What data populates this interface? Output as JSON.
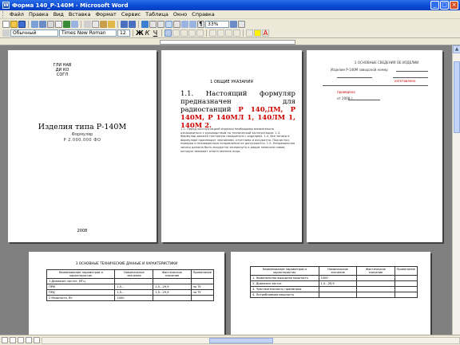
{
  "window": {
    "title": "Форма 140_Р-140М - Microsoft Word",
    "buttons": [
      "_",
      "□",
      "×"
    ]
  },
  "menubar": {
    "items": [
      "Файл",
      "Правка",
      "Вид",
      "Вставка",
      "Формат",
      "Сервис",
      "Таблица",
      "Окно",
      "Справка"
    ]
  },
  "toolbar": {
    "zoom": "33%",
    "style": "Обычный",
    "font": "Times New Roman",
    "font_size": "12"
  },
  "pages": {
    "p1": {
      "org_line1": "ГЛИ НАВ",
      "org_line2": "ДИ КО СОГЛ",
      "title": "Изделия типа Р-140М",
      "subtitle": "Формуляр",
      "code": "Р 2.000.000 ФО",
      "year": "2008"
    },
    "p2": {
      "heading": "1 ОБЩИЕ УКАЗАНИЯ",
      "para_plain": "1.1. Настоящий формуляр предназначен для радиостанций",
      "para_red": "Р 140,ДМ, Р 140М, Р 140МЛ 1, 140ЛМ 1, 140М 2.",
      "small_text": "1.2. Перед эксплуатацией изделия необходимо внимательно ознакомиться с руководством по технической эксплуатации. 1.3. Формуляр должен постоянно находиться с изделием. 1.4. Все записи в формуляре производят чернилами, отчетливо и аккуратно. Подчистки, помарки и незаверенные исправления не допускаются. 1.5. Неправильная запись должна быть аккуратно зачеркнута и рядом записана новая, которую заверяет ответственное лицо."
    },
    "p3": {
      "line1": "2 ОСНОВНЫЕ СВЕДЕНИЯ ОБ ИЗДЕЛИИ",
      "line2": "Изделие Р-140М заводской номер",
      "line3": "изготовлено",
      "line4": "проведена",
      "line5": "от 2008 г."
    },
    "p4": {
      "caption": "3 ОСНОВНЫЕ ТЕХНИЧЕСКИЕ ДАННЫЕ И ХАРАКТЕРИСТИКИ",
      "headers": [
        "Наименование параметров и характеристик",
        "Номинальное значение",
        "Фактическое значение",
        "Примечание"
      ],
      "rows": [
        [
          "1 Диапазон частот, МГц",
          "",
          "",
          ""
        ],
        [
          "ПРМ",
          "1,5...",
          "1,5...29,9",
          "по ТУ"
        ],
        [
          "ПРД",
          "1,5...",
          "1,5...29,9",
          "по ТУ"
        ],
        [
          "2 Мощность, Вт",
          "1000",
          "",
          ""
        ]
      ]
    },
    "p5": {
      "headers": [
        "Наименование параметров и характеристик",
        "Номинальное значение",
        "Фактическое значение",
        "Примечание"
      ],
      "rows": [
        [
          "1. Номинальная выходная мощность",
          "1000",
          "",
          ""
        ],
        [
          "2. Диапазон частот",
          "1,5...29,9",
          "",
          ""
        ],
        [
          "3. Чувствительность приемника",
          "",
          "",
          ""
        ],
        [
          "4. Потребляемая мощность",
          "",
          "",
          ""
        ]
      ]
    }
  }
}
